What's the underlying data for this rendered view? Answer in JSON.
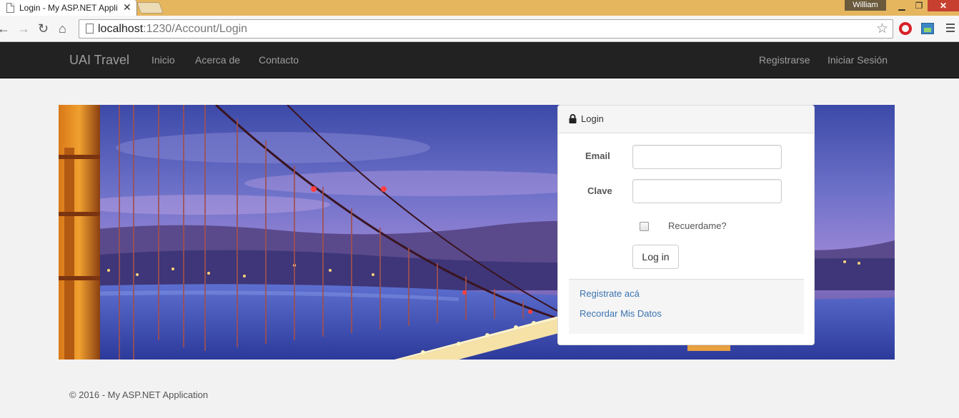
{
  "browser": {
    "tab_title": "Login - My ASP.NET Appli",
    "tab_close": "✕",
    "user_name": "William",
    "url_host": "localhost",
    "url_rest": ":1230/Account/Login",
    "win_min": "▁",
    "win_max": "❐",
    "win_close": "✕"
  },
  "navbar": {
    "brand": "UAI Travel",
    "left_links": [
      "Inicio",
      "Acerca de",
      "Contacto"
    ],
    "right_links": [
      "Registrarse",
      "Iniciar Sesión"
    ]
  },
  "login": {
    "title": "Login",
    "email_label": "Email",
    "email_value": "",
    "password_label": "Clave",
    "password_value": "",
    "remember_label": "Recuerdame?",
    "remember_checked": false,
    "submit_label": "Log in",
    "links": [
      "Registrate acá",
      "Recordar Mis Datos"
    ]
  },
  "footer": {
    "copyright": "© 2016 - My ASP.NET Application"
  },
  "colors": {
    "navbar_bg": "#222222",
    "navbar_text": "#9d9d9d",
    "link": "#3a73b0",
    "page_bg": "#f2f2f2",
    "chrome_frame": "#e6b65f"
  }
}
